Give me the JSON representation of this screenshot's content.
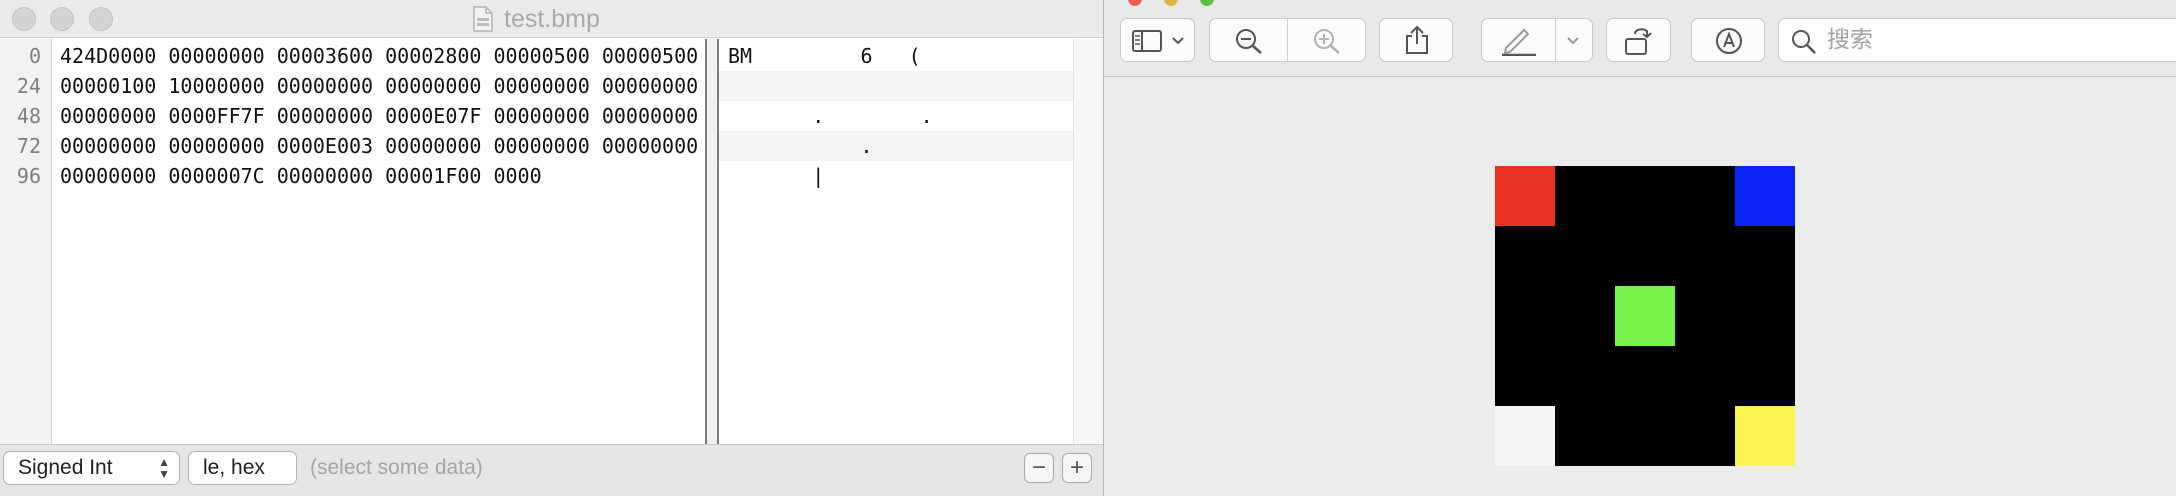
{
  "hex_editor": {
    "title": "test.bmp",
    "offsets": [
      "0",
      "24",
      "48",
      "72",
      "96"
    ],
    "hex_rows": [
      "424D0000 00000000 00003600 00002800 00000500 00000500",
      "00000100 10000000 00000000 00000000 00000000 00000000",
      "00000000 0000FF7F 00000000 0000E07F 00000000 00000000",
      "00000000 00000000 0000E003 00000000 00000000 00000000",
      "00000000 0000007C 00000000 00001F00 0000"
    ],
    "ascii_rows": [
      "BM         6   (",
      "",
      "       .        .",
      "           .",
      "       |"
    ],
    "status": {
      "type_popup": "Signed Int",
      "endian_popup": "le, hex",
      "selection_hint": "(select some data)",
      "minus_label": "−",
      "plus_label": "+"
    }
  },
  "preview": {
    "search_placeholder": "搜索",
    "toolbar_icons": [
      "sidebar-icon",
      "chevron-down-icon",
      "zoom-out-icon",
      "zoom-in-icon",
      "share-icon",
      "markup-pen-icon",
      "chevron-down-icon",
      "rotate-icon",
      "annotate-icon",
      "search-icon"
    ],
    "image": {
      "grid_size": 5,
      "background": "#000000",
      "pixels": [
        {
          "row": 0,
          "col": 0,
          "color": "#e73323"
        },
        {
          "row": 0,
          "col": 4,
          "color": "#0a23f5"
        },
        {
          "row": 2,
          "col": 2,
          "color": "#77f24b"
        },
        {
          "row": 4,
          "col": 0,
          "color": "#f5f5f5"
        },
        {
          "row": 4,
          "col": 4,
          "color": "#f8f552"
        }
      ]
    }
  },
  "colors": {
    "traffic_close": "#ec5f57",
    "traffic_min": "#e1b43d",
    "traffic_max": "#5cc23f"
  }
}
